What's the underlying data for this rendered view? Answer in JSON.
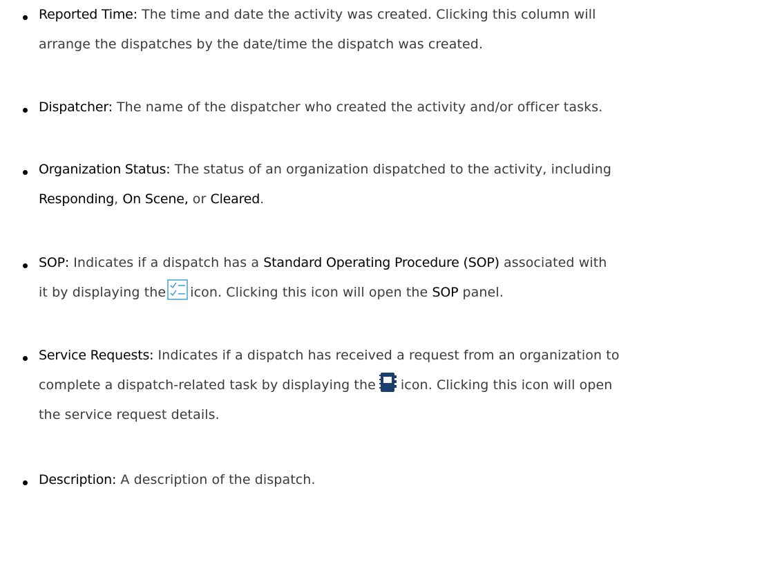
{
  "items": [
    {
      "term": "Reported Time:",
      "line1": " The time and date the activity was created. Clicking this column will",
      "line2": "arrange the dispatches by the date/time the dispatch was created."
    },
    {
      "term": "Dispatcher:",
      "line1": " The name of the dispatcher who created the activity and/or officer tasks."
    },
    {
      "term": "Organization Status:",
      "line1": " The status of an organization dispatched to the activity, including",
      "line2_terms": [
        "Responding",
        "On Scene,",
        "Cleared"
      ],
      "line2_sep1": ", ",
      "line2_sep2": " or ",
      "line2_end": "."
    },
    {
      "term": "SOP:",
      "line1_a": " Indicates if a dispatch has a ",
      "line1_term": "Standard Operating Procedure (SOP)",
      "line1_b": " associated with",
      "line2_a": "it by displaying the",
      "line2_b": "icon. Clicking this icon will open the ",
      "line2_term": "SOP",
      "line2_c": " panel.",
      "icon": "sop-checklist-icon",
      "icon_color": "#4aa7d8"
    },
    {
      "term": "Service Requests:",
      "line1": " Indicates if a dispatch has received a request from an organization to",
      "line2_a": "complete a dispatch-related task by displaying the",
      "line2_b": "icon. Clicking this icon will open",
      "line3": "the service request details.",
      "icon": "service-request-notebook-icon",
      "icon_color": "#1b3f6e"
    },
    {
      "term": "Description:",
      "line1": " A description of the dispatch."
    }
  ]
}
